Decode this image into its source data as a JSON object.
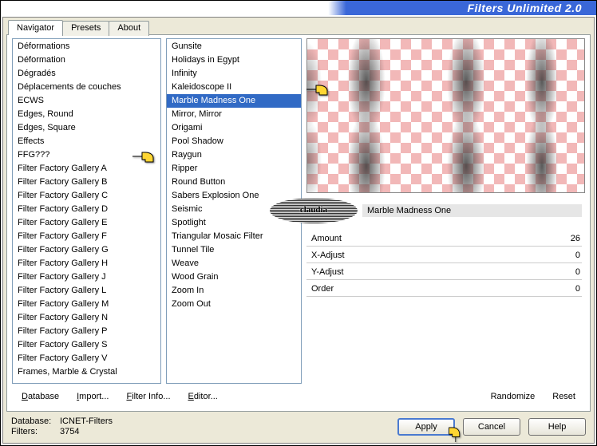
{
  "title": "Filters Unlimited 2.0",
  "tabs": [
    "Navigator",
    "Presets",
    "About"
  ],
  "active_tab": 0,
  "category_list": [
    "Déformations",
    "Déformation",
    "Dégradés",
    "Déplacements de couches",
    "ECWS",
    "Edges, Round",
    "Edges, Square",
    "Effects",
    "FFG???",
    "Filter Factory Gallery A",
    "Filter Factory Gallery B",
    "Filter Factory Gallery C",
    "Filter Factory Gallery D",
    "Filter Factory Gallery E",
    "Filter Factory Gallery F",
    "Filter Factory Gallery G",
    "Filter Factory Gallery H",
    "Filter Factory Gallery J",
    "Filter Factory Gallery L",
    "Filter Factory Gallery M",
    "Filter Factory Gallery N",
    "Filter Factory Gallery P",
    "Filter Factory Gallery S",
    "Filter Factory Gallery V",
    "Frames, Marble & Crystal"
  ],
  "category_selected": 9,
  "filter_list": [
    "Gunsite",
    "Holidays in Egypt",
    "Infinity",
    "Kaleidoscope II",
    "Marble Madness One",
    "Mirror, Mirror",
    "Origami",
    "Pool Shadow",
    "Raygun",
    "Ripper",
    "Round Button",
    "Sabers Explosion One",
    "Seismic",
    "Spotlight",
    "Triangular Mosaic Filter",
    "Tunnel Tile",
    "Weave",
    "Wood Grain",
    "Zoom In",
    "Zoom Out"
  ],
  "filter_selected": 4,
  "current_filter_name": "Marble Madness One",
  "logo_text": "claudia",
  "params": [
    {
      "name": "Amount",
      "value": "26"
    },
    {
      "name": "X-Adjust",
      "value": "0"
    },
    {
      "name": "Y-Adjust",
      "value": "0"
    },
    {
      "name": "Order",
      "value": "0"
    }
  ],
  "link_buttons": {
    "database": "Database",
    "import": "Import...",
    "filter_info": "Filter Info...",
    "editor": "Editor...",
    "randomize": "Randomize",
    "reset": "Reset"
  },
  "status": {
    "db_label": "Database:",
    "db_value": "ICNET-Filters",
    "filters_label": "Filters:",
    "filters_value": "3754"
  },
  "buttons": {
    "apply": "Apply",
    "cancel": "Cancel",
    "help": "Help"
  }
}
